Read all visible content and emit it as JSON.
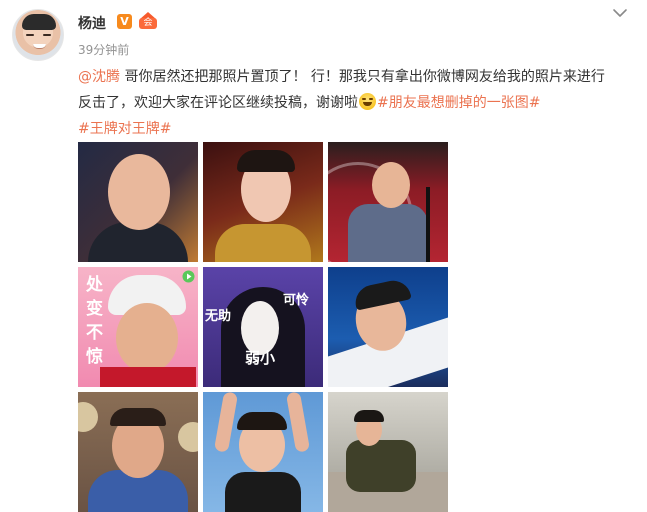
{
  "post": {
    "author": "杨迪",
    "verified_badge": "V",
    "member_badge": "会",
    "time": "39分钟前",
    "chevron_icon": "chevron-down-icon",
    "text": {
      "mention": "@沈腾",
      "body": " 哥你居然还把那照片置顶了！ 行！那我只有拿出你微博网友给我的照片来进行反击了，欢迎大家在评论区继续投稿，谢谢啦",
      "emoji": "laughing-emoji",
      "hashtag1": "#朋友最想删掉的一张图#",
      "hashtag2": "#王牌对王牌#"
    }
  },
  "photos": {
    "p4_overlay": [
      "处",
      "变",
      "不",
      "惊"
    ],
    "p5_overlay_left": "无助",
    "p5_overlay_right": "可怜",
    "p5_overlay_bottom": "弱小"
  },
  "colors": {
    "link": "#eb7350",
    "badge_orange": "#f78a1d",
    "time_gray": "#939393"
  }
}
